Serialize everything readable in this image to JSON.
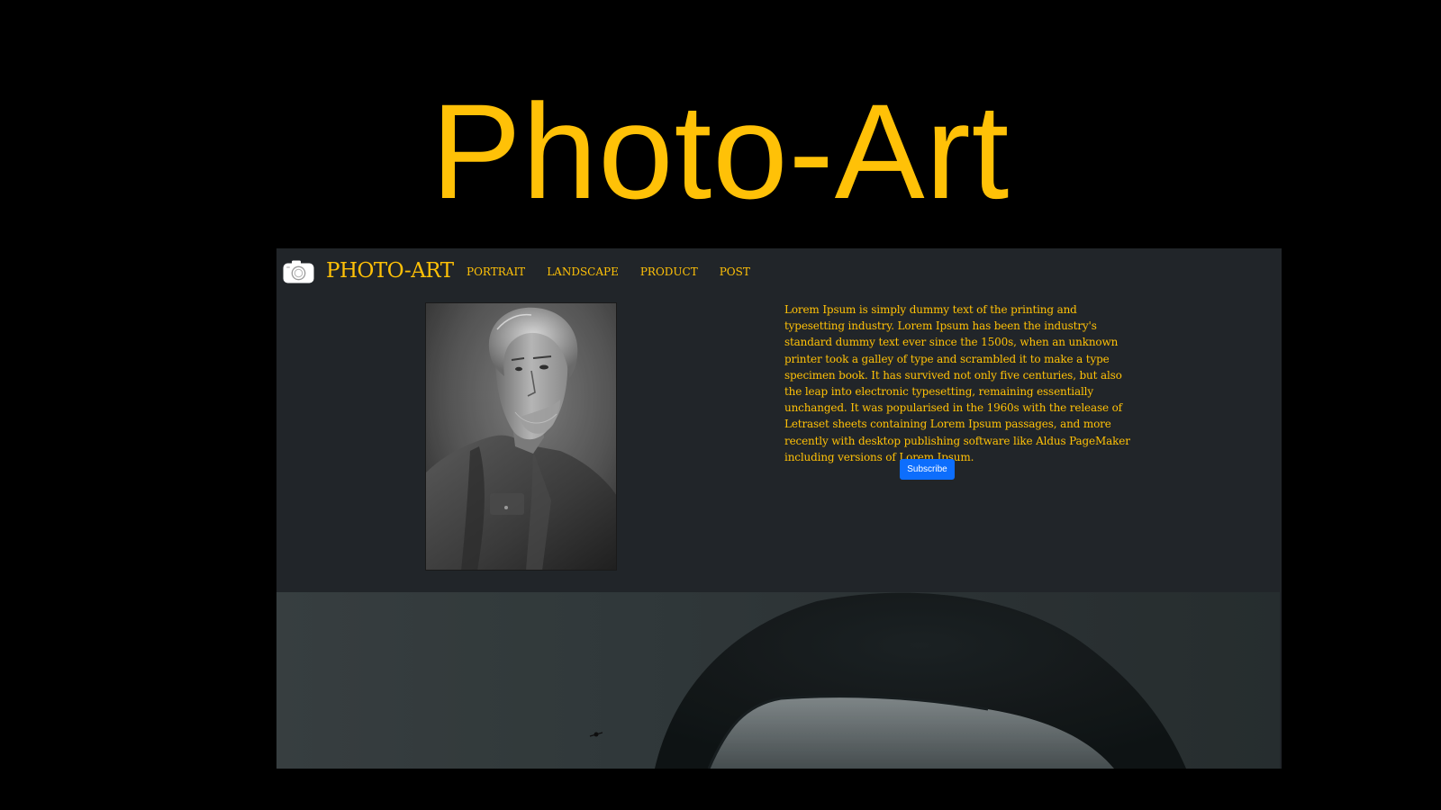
{
  "hero": {
    "title": "Photo-Art"
  },
  "navbar": {
    "brand_icon": "camera-icon",
    "brand_name": "PHOTO-ART",
    "links": [
      {
        "label": "PORTRAIT"
      },
      {
        "label": "LANDSCAPE"
      },
      {
        "label": "PRODUCT"
      },
      {
        "label": "POST"
      }
    ]
  },
  "intro": {
    "text": "Lorem Ipsum is simply dummy text of the printing and typesetting industry. Lorem Ipsum has been the industry's standard dummy text ever since the 1500s, when an unknown printer took a galley of type and scrambled it to make a type specimen book. It has survived not only five centuries, but also the leap into electronic typesetting, remaining essentially unchanged. It was popularised in the 1960s with the release of Letraset sheets containing Lorem Ipsum passages, and more recently with desktop publishing software like Aldus PageMaker including versions of Lorem Ipsum.",
    "subscribe_label": "Subscribe"
  },
  "colors": {
    "page_background": "#000000",
    "site_background": "#212529",
    "accent": "#ffc107",
    "button": "#0d6efd"
  }
}
